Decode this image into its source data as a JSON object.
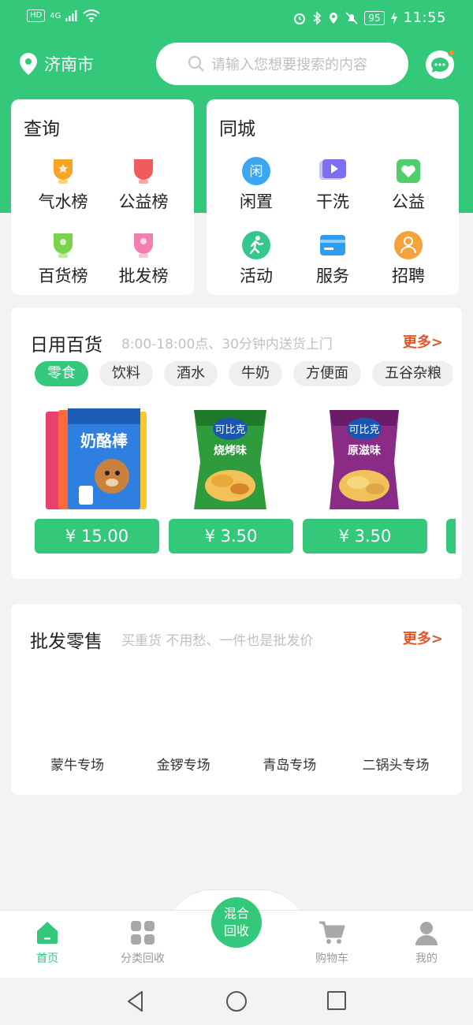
{
  "statusbar": {
    "hd": "HD",
    "network": "4G",
    "battery": "95",
    "time": "11:55"
  },
  "header": {
    "city": "济南市",
    "search_placeholder": "请输入您想要搜索的内容"
  },
  "query_card": {
    "title": "查询",
    "items": [
      {
        "label": "气水榜",
        "icon": "trophy-orange-icon",
        "color": "#f6a623"
      },
      {
        "label": "公益榜",
        "icon": "trophy-red-icon",
        "color": "#f25b5b"
      },
      {
        "label": "百货榜",
        "icon": "trophy-green-icon",
        "color": "#7ad34c"
      },
      {
        "label": "批发榜",
        "icon": "trophy-pink-icon",
        "color": "#f27fb0"
      }
    ]
  },
  "city_card": {
    "title": "同城",
    "items": [
      {
        "label": "闲置",
        "icon": "idle-icon",
        "glyph": "闲",
        "color": "#3aa8f0"
      },
      {
        "label": "干洗",
        "icon": "video-play-icon",
        "color": "#7e6ff2"
      },
      {
        "label": "公益",
        "icon": "heart-icon",
        "color": "#4fcf6b"
      },
      {
        "label": "活动",
        "icon": "running-icon",
        "color": "#34c78e"
      },
      {
        "label": "服务",
        "icon": "card-icon",
        "color": "#2e9cf0"
      },
      {
        "label": "招聘",
        "icon": "person-icon",
        "color": "#f5a23a"
      }
    ]
  },
  "daily_section": {
    "title": "日用百货",
    "subtitle": "8:00-18:00点、30分钟内送货上门",
    "more": "更多>",
    "chips": [
      {
        "label": "零食",
        "active": true
      },
      {
        "label": "饮料",
        "active": false
      },
      {
        "label": "酒水",
        "active": false
      },
      {
        "label": "牛奶",
        "active": false
      },
      {
        "label": "方便面",
        "active": false
      },
      {
        "label": "五谷杂粮",
        "active": false
      }
    ],
    "products": [
      {
        "price": "¥ 15.00",
        "image": "dog-snack-bag-image",
        "color": "#e8406f"
      },
      {
        "price": "¥ 3.50",
        "image": "green-chips-bag-image",
        "color": "#2e9b3c"
      },
      {
        "price": "¥ 3.50",
        "image": "purple-chips-bag-image",
        "color": "#8a2b86"
      }
    ]
  },
  "wholesale_section": {
    "title": "批发零售",
    "subtitle": "买重货 不用愁、一件也是批发价",
    "more": "更多>",
    "brands": [
      "蒙牛专场",
      "金锣专场",
      "青岛专场",
      "二锅头专场"
    ]
  },
  "bottom_nav": {
    "items": [
      {
        "label": "首页",
        "icon": "home-icon",
        "active": true
      },
      {
        "label": "分类回收",
        "icon": "grid-icon",
        "active": false
      },
      {
        "label": "购物车",
        "icon": "cart-icon",
        "active": false
      },
      {
        "label": "我的",
        "icon": "user-icon",
        "active": false
      }
    ],
    "center_line1": "混合",
    "center_line2": "回收"
  },
  "colors": {
    "brand": "#33c87a",
    "more": "#e0582a"
  }
}
